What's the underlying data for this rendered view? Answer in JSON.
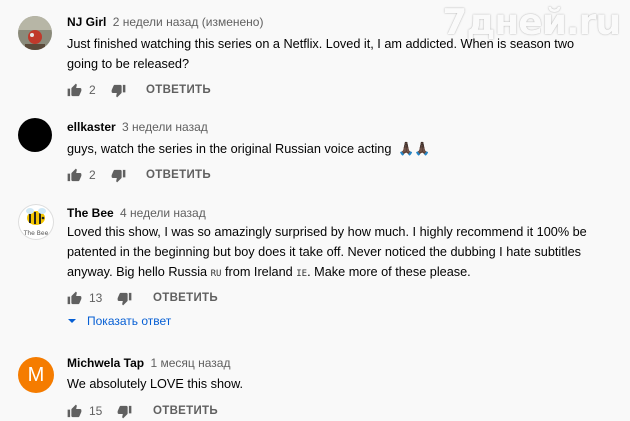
{
  "watermark": "7дней.ru",
  "comments": [
    {
      "author": "NJ Girl",
      "meta": "2 недели назад (изменено)",
      "lines": [
        "Just finished watching this series on a Netflix.  Loved it, I am addicted.  When is season two",
        "going to be released?"
      ],
      "likes": "2",
      "reply_label": "ОТВЕТИТЬ"
    },
    {
      "author": "ellkaster",
      "meta": "3 недели назад",
      "text": "guys, watch the series in the original Russian voice acting",
      "emoji": "🙏🏿🙏🏿",
      "likes": "2",
      "reply_label": "ОТВЕТИТЬ"
    },
    {
      "author": "The Bee",
      "meta": "4 недели назад",
      "avatar_caption": "The Bee",
      "lines": [
        "Loved this show, I was so amazingly surprised by how much. I highly recommend it 100% be",
        "patented in the beginning but boy does it take off. Never noticed the dubbing I hate subtitles"
      ],
      "line3_a": "anyway. Big hello Russia",
      "flag_ru": "RU",
      "line3_b": "from Ireland",
      "flag_ie": "IE",
      "line3_c": ". Make more of these please.",
      "likes": "13",
      "reply_label": "ОТВЕТИТЬ",
      "show_replies": "Показать ответ"
    },
    {
      "author": "Michwela Tap",
      "meta": "1 месяц назад",
      "avatar_letter": "M",
      "text": "We absolutely LOVE this show.",
      "likes": "15",
      "reply_label": "ОТВЕТИТЬ"
    }
  ],
  "colors": {
    "meta": "#606060",
    "link": "#065fd4",
    "avatar_orange": "#f57c00"
  }
}
